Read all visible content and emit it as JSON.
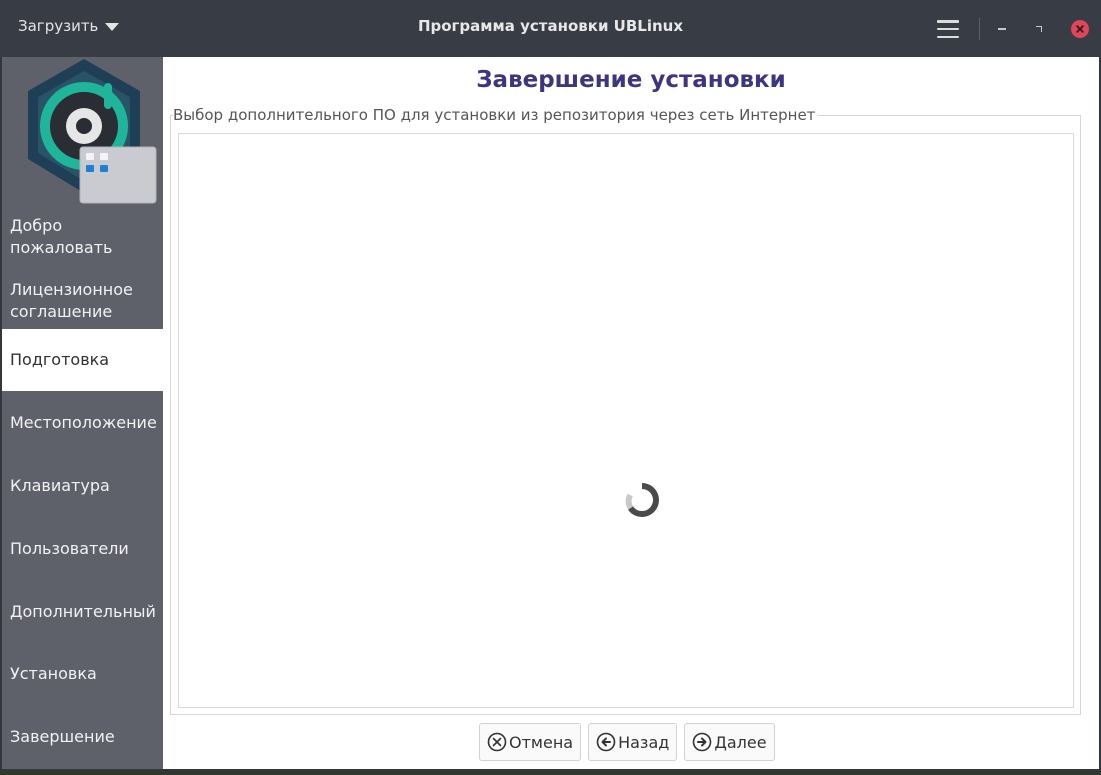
{
  "titlebar": {
    "menu_label": "Загрузить",
    "title": "Программа установки UBLinux"
  },
  "sidebar": {
    "items": [
      {
        "label": "Добро\nпожаловать",
        "active": false
      },
      {
        "label": "Лицензионное\nсоглашение",
        "active": false
      },
      {
        "label": "Подготовка",
        "active": true
      },
      {
        "label": "Местоположение",
        "active": false
      },
      {
        "label": "Клавиатура",
        "active": false
      },
      {
        "label": "Пользователи",
        "active": false
      },
      {
        "label": "Дополнительный",
        "active": false
      },
      {
        "label": "Установка",
        "active": false
      },
      {
        "label": "Завершение",
        "active": false
      }
    ]
  },
  "main": {
    "title": "Завершение установки",
    "group_label": "Выбор дополнительного ПО для установки из репозитория через сеть Интернет",
    "loading": true
  },
  "buttons": {
    "cancel": "Отмена",
    "back": "Назад",
    "next": "Далее"
  },
  "colors": {
    "title_accent": "#3d3580",
    "close_button": "#e0455a",
    "sidebar_bg": "#5f616a",
    "logo_teal": "#1fb59a"
  },
  "icons": {
    "menu": "hamburger-icon",
    "cancel": "cancel-circle-icon",
    "back": "arrow-left-circle-icon",
    "next": "arrow-right-circle-icon",
    "spinner": "loading-spinner-icon"
  }
}
